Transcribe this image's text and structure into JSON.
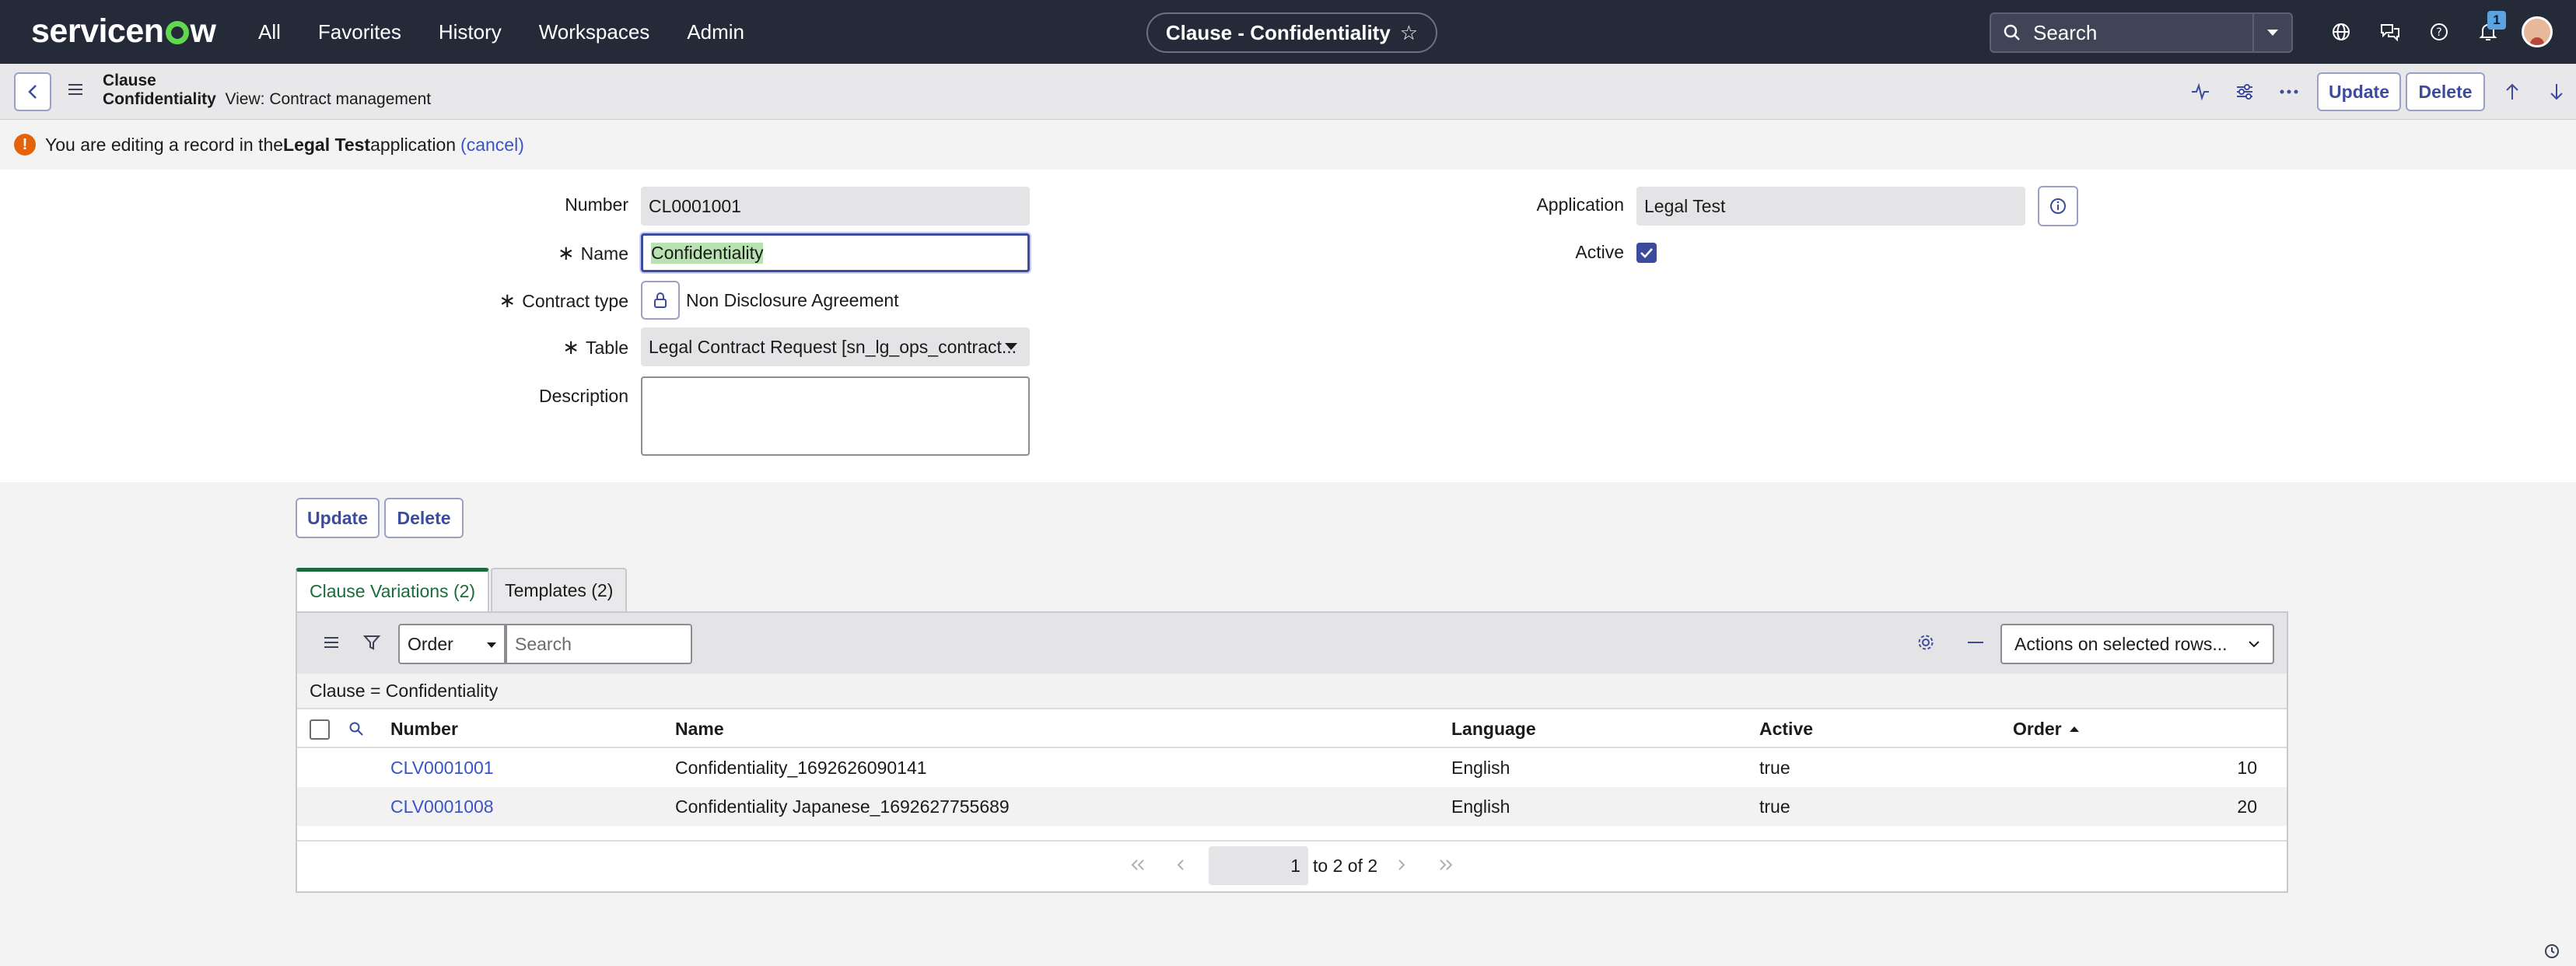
{
  "nav": {
    "logo": "servicenow",
    "links": [
      "All",
      "Favorites",
      "History",
      "Workspaces",
      "Admin"
    ],
    "title": "Clause - Confidentiality",
    "search_placeholder": "Search",
    "notification_count": "1"
  },
  "header": {
    "record_type": "Clause",
    "record_name": "Confidentiality",
    "view_label": "View: Contract management",
    "update_label": "Update",
    "delete_label": "Delete"
  },
  "banner": {
    "prefix": "You are editing a record in the ",
    "app": "Legal Test",
    "suffix": " application",
    "cancel": "(cancel)"
  },
  "form": {
    "number_label": "Number",
    "number_value": "CL0001001",
    "name_label": "Name",
    "name_value": "Confidentiality",
    "contract_type_label": "Contract type",
    "contract_type_value": "Non Disclosure Agreement",
    "table_label": "Table",
    "table_value": "Legal Contract Request [sn_lg_ops_contract...",
    "description_label": "Description",
    "description_value": "",
    "application_label": "Application",
    "application_value": "Legal Test",
    "active_label": "Active",
    "active_checked": true,
    "required_mark": "∗"
  },
  "buttons": {
    "update": "Update",
    "delete": "Delete"
  },
  "related": {
    "tabs": [
      "Clause Variations (2)",
      "Templates (2)"
    ],
    "order_select": "Order",
    "search_placeholder": "Search",
    "actions_select": "Actions on selected rows...",
    "breadcrumb": "Clause = Confidentiality",
    "columns": [
      "Number",
      "Name",
      "Language",
      "Active",
      "Order"
    ],
    "rows": [
      [
        "CLV0001001",
        "Confidentiality_1692626090141",
        "English",
        "true",
        "10"
      ],
      [
        "CLV0001008",
        "Confidentiality Japanese_1692627755689",
        "English",
        "true",
        "20"
      ]
    ],
    "page_value": "1",
    "page_text": "to 2 of 2"
  },
  "icons": [
    "search-icon",
    "globe-icon",
    "chat-icon",
    "help-icon",
    "bell-icon",
    "back-icon",
    "menu-icon",
    "activity-icon",
    "settings-sliders-icon",
    "more-icon",
    "arrow-up-icon",
    "arrow-down-icon",
    "lock-icon",
    "info-icon",
    "filter-icon",
    "gear-icon",
    "minus-icon",
    "star-icon"
  ],
  "colors": {
    "nav_bg": "#252a39",
    "accent": "#3c4b9c",
    "link": "#3a54c4",
    "tab_active": "#1b6b3c",
    "warning": "#e4630a",
    "logo_green": "#62d84e"
  }
}
